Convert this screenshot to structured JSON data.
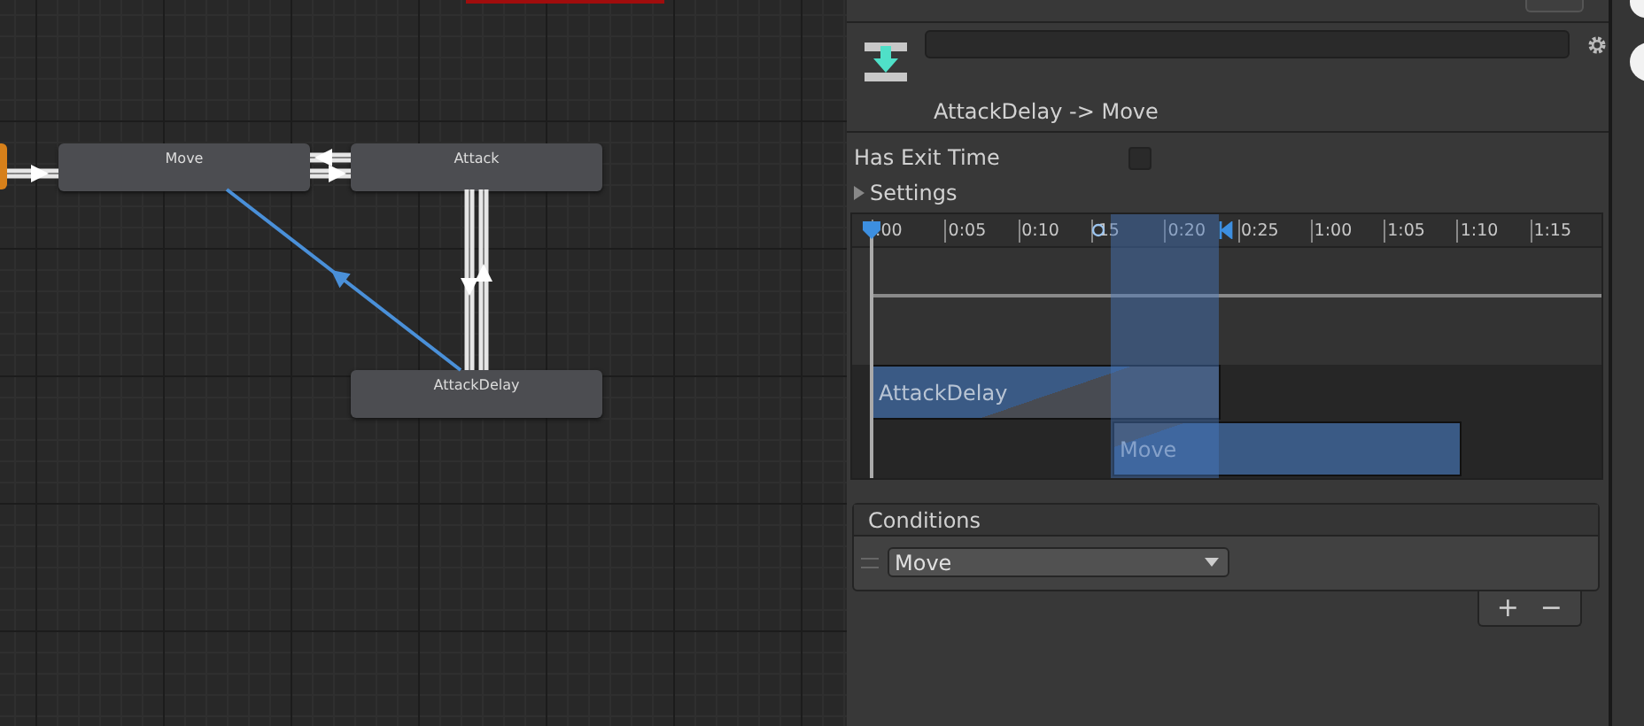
{
  "graph": {
    "states": [
      {
        "name": "Move"
      },
      {
        "name": "Attack"
      },
      {
        "name": "AttackDelay"
      }
    ],
    "transitions": [
      {
        "selected": false
      },
      {
        "selected": false
      },
      {
        "selected": false
      },
      {
        "selected": false
      },
      {
        "selected": false
      },
      {
        "selected": true
      }
    ]
  },
  "inspector": {
    "title": "AttackDelay -> Move",
    "has_exit_time": {
      "label": "Has Exit Time",
      "checked": false
    },
    "settings": {
      "label": "Settings",
      "expanded": false
    },
    "timeline": {
      "ticks": [
        ":00",
        "0:05",
        "0:10",
        "15",
        "0:20",
        "0:25",
        "1:00",
        "1:05",
        "1:10",
        "1:15"
      ],
      "clips": [
        {
          "name": "AttackDelay"
        },
        {
          "name": "Move"
        }
      ]
    },
    "conditions": {
      "title": "Conditions",
      "items": [
        {
          "value": "Move"
        }
      ],
      "add": "+",
      "remove": "−"
    }
  }
}
